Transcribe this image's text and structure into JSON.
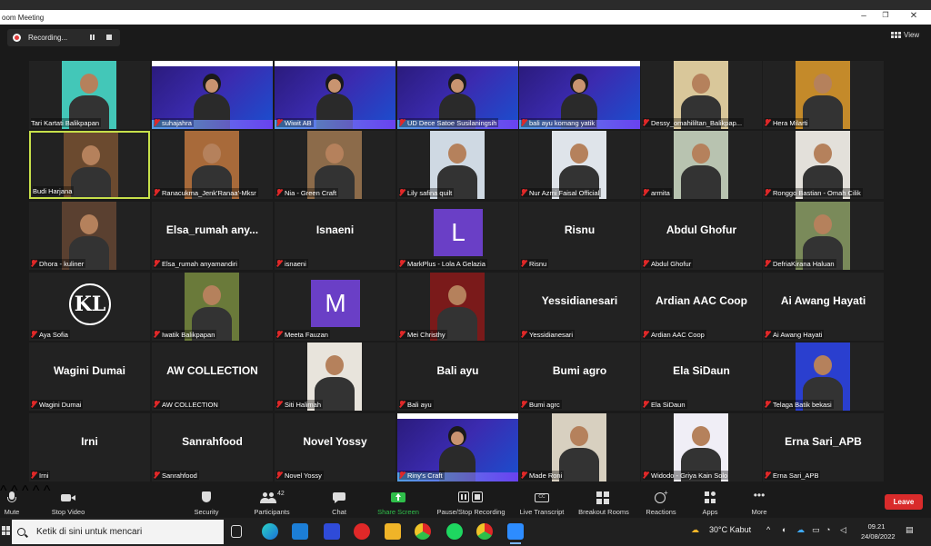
{
  "window": {
    "title": "oom Meeting"
  },
  "recording": {
    "label": "Recording..."
  },
  "view": {
    "label": "View"
  },
  "tiles": [
    {
      "name": "Tari Kartati Balikpapan",
      "kind": "video",
      "bg": "#43c7b8"
    },
    {
      "name": "suhajahra",
      "kind": "slide"
    },
    {
      "name": "Wiwit AB",
      "kind": "slide"
    },
    {
      "name": "UD Dece Satoe Susilaningsih",
      "kind": "slide"
    },
    {
      "name": "bali ayu komang yatik",
      "kind": "slide"
    },
    {
      "name": "Dessy_omahililtan_Balikpap...",
      "kind": "video",
      "bg": "#d9c79a"
    },
    {
      "name": "Hera Milarti",
      "kind": "video",
      "bg": "#c48a2a"
    },
    {
      "name": "Budi Harjana",
      "kind": "video",
      "bg": "#6b4a2f",
      "active": true
    },
    {
      "name": "Ranacukma_Jenk'Ranaa'-Mksr",
      "kind": "video",
      "bg": "#a86a3a"
    },
    {
      "name": "Nia - Green Craft",
      "kind": "video",
      "bg": "#8c6b4a"
    },
    {
      "name": "Lily safina quilt",
      "kind": "video",
      "bg": "#cfd9e3"
    },
    {
      "name": "Nur Azmi Faisal Official",
      "kind": "video",
      "bg": "#dfe4ea"
    },
    {
      "name": "armita",
      "kind": "video",
      "bg": "#b8c3b0"
    },
    {
      "name": "Ronggo Bastian - Omah Cilik",
      "kind": "video",
      "bg": "#e3e0da"
    },
    {
      "name": "Dhora - kuliner",
      "kind": "video",
      "bg": "#5a4030"
    },
    {
      "name": "Elsa_rumah anyamandiri",
      "kind": "text",
      "big": "Elsa_rumah  any..."
    },
    {
      "name": "isnaeni",
      "kind": "text",
      "big": "Isnaeni"
    },
    {
      "name": "MarkPlus - Lola A Gelazia",
      "kind": "avatar",
      "letter": "L"
    },
    {
      "name": "Risnu",
      "kind": "text",
      "big": "Risnu"
    },
    {
      "name": "Abdul Ghofur",
      "kind": "text",
      "big": "Abdul Ghofur"
    },
    {
      "name": "DefriaKirana Haluan",
      "kind": "video",
      "bg": "#7a8a5a"
    },
    {
      "name": "Aya Sofia",
      "kind": "logo",
      "big": "KL"
    },
    {
      "name": "Iwatik Balikpapan",
      "kind": "video",
      "bg": "#6a7a3a"
    },
    {
      "name": "Meeta Fauzan",
      "kind": "avatar",
      "letter": "M"
    },
    {
      "name": "Mei Christhy",
      "kind": "video",
      "bg": "#7a1a1a"
    },
    {
      "name": "Yessidianesari",
      "kind": "text",
      "big": "Yessidianesari"
    },
    {
      "name": "Ardian AAC Coop",
      "kind": "text",
      "big": "Ardian AAC Coop"
    },
    {
      "name": "Ai Awang Hayati",
      "kind": "text",
      "big": "Ai Awang Hayati"
    },
    {
      "name": "Wagini Dumai",
      "kind": "text",
      "big": "Wagini Dumai"
    },
    {
      "name": "AW COLLECTION",
      "kind": "text",
      "big": "AW COLLECTION"
    },
    {
      "name": "Siti Halimah",
      "kind": "video",
      "bg": "#e8e4dc"
    },
    {
      "name": "Bali ayu",
      "kind": "text",
      "big": "Bali ayu"
    },
    {
      "name": "Bumi agrc",
      "kind": "text",
      "big": "Bumi agro"
    },
    {
      "name": "Ela SiDaun",
      "kind": "text",
      "big": "Ela SiDaun"
    },
    {
      "name": "Telaga Batik bekasi",
      "kind": "video",
      "bg": "#2a3fcf"
    },
    {
      "name": "Irni",
      "kind": "text",
      "big": "Irni"
    },
    {
      "name": "Sanrahfood",
      "kind": "text",
      "big": "Sanrahfood"
    },
    {
      "name": "Novel Yossy",
      "kind": "text",
      "big": "Novel Yossy"
    },
    {
      "name": "Riny's Craft",
      "kind": "slide"
    },
    {
      "name": "Made Roni",
      "kind": "video",
      "bg": "#d8d0c0"
    },
    {
      "name": "Widodo - Griya Kain Solo",
      "kind": "video",
      "bg": "#f0eef6"
    },
    {
      "name": "Erna Sari_APB",
      "kind": "text",
      "big": "Erna Sari_APB"
    }
  ],
  "toolbar": {
    "mute": "Mute",
    "stop_video": "Stop Video",
    "security": "Security",
    "participants": "Participants",
    "participants_count": "42",
    "chat": "Chat",
    "share_screen": "Share Screen",
    "pause_recording": "Pause/Stop Recording",
    "live_transcript": "Live Transcript",
    "breakout_rooms": "Breakout Rooms",
    "reactions": "Reactions",
    "apps": "Apps",
    "more": "More",
    "leave": "Leave"
  },
  "taskbar": {
    "search_placeholder": "Ketik di sini untuk mencari",
    "weather": "30°C  Kabut",
    "time": "09.21",
    "date": "24/08/2022"
  },
  "colors": {
    "leave": "#d92b2b",
    "active_speaker": "#c7e04a",
    "muted_mic": "#e02828",
    "share_screen": "#2fbf4a"
  }
}
